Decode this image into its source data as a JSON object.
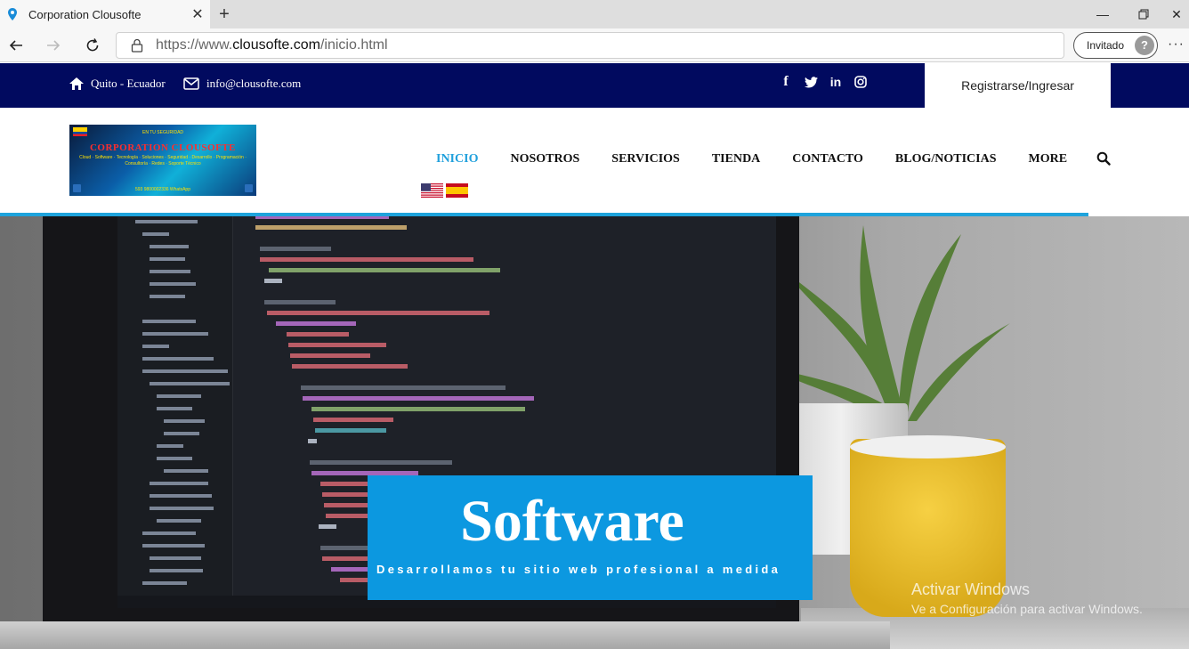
{
  "browser": {
    "tab_title": "Corporation Clousofte",
    "url_prefix": "https://www.",
    "url_host": "clousofte.com",
    "url_path": "/inicio.html",
    "profile_label": "Invitado"
  },
  "topbar": {
    "location": "Quito - Ecuador",
    "email": "info@clousofte.com",
    "auth_label": "Registrarse/Ingresar",
    "socials": [
      "facebook-icon",
      "twitter-icon",
      "linkedin-icon",
      "instagram-icon"
    ]
  },
  "logo": {
    "top_text": "EN TU SEGURIDAD",
    "title": "CORPORATION CLOUSOFTE",
    "subtitle": "Cloud · Software · Tecnología · Soluciones · Seguridad · Desarrollo · Programación · Consultoría · Redes · Soporte Técnico",
    "whatsapp": "593 9800002336 WhatsApp"
  },
  "nav": {
    "items": [
      {
        "label": "INICIO",
        "active": true
      },
      {
        "label": "NOSOTROS",
        "active": false
      },
      {
        "label": "SERVICIOS",
        "active": false
      },
      {
        "label": "TIENDA",
        "active": false
      },
      {
        "label": "CONTACTO",
        "active": false
      },
      {
        "label": "BLOG/NOTICIAS",
        "active": false
      },
      {
        "label": "MORE",
        "active": false
      }
    ],
    "languages": [
      "en-US",
      "es-ES"
    ]
  },
  "hero": {
    "title": "Software",
    "subtitle": "Desarrollamos tu sitio web profesional a medida"
  },
  "watermark": {
    "line1": "Activar Windows",
    "line2": "Ve a Configuración para activar Windows."
  },
  "colors": {
    "topbar_bg": "#010a5f",
    "accent": "#1ea3dc",
    "hero_box": "#0c98e0"
  }
}
